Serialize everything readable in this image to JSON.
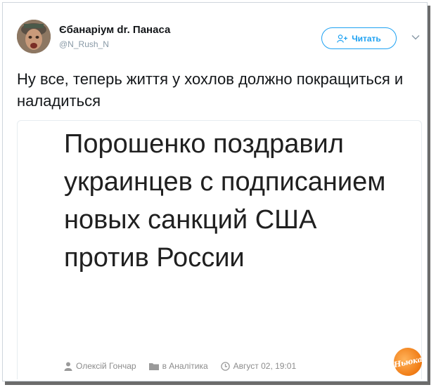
{
  "tweet": {
    "author": {
      "display_name": "Єбанаріум dr. Панаса",
      "handle": "@N_Rush_N",
      "avatar_icon": "avatar-photo"
    },
    "follow_button": {
      "label": "Читать",
      "icon": "add-user-icon",
      "color": "#1da1f2"
    },
    "menu_icon": "chevron-down-icon",
    "text": "Ну все, теперь життя у хохлов должно покращиться и наладиться"
  },
  "card": {
    "headline": "Порошенко поздравил украинцев с подписанием новых санкций США против России",
    "meta": {
      "author": "Олексій Гончар",
      "category": "в Аналітика",
      "date": "Август 02, 19:01"
    }
  },
  "watermark": {
    "text": "Ньюка"
  }
}
